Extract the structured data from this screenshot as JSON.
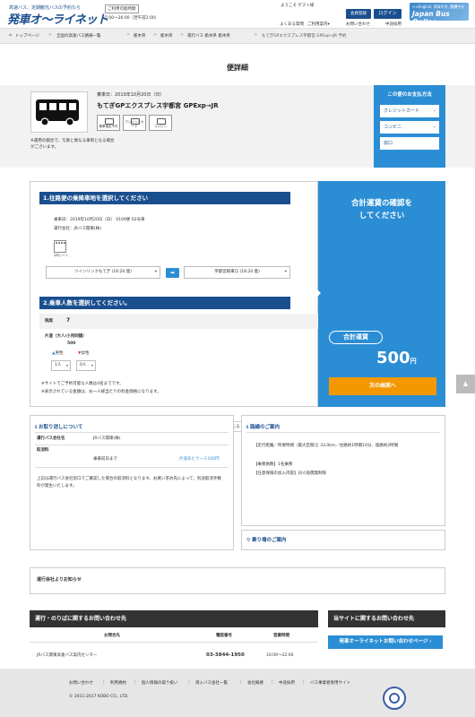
{
  "header": {
    "tagline": "高速バス、定期観光バスの予約なら",
    "logo": "発車オ〜ライネット",
    "hours_label": "ご利用可能時間",
    "hours": "5:00〜26:00（翌午前2:00）",
    "welcome": "ようこそ ゲスト様",
    "register": "会員登録",
    "login": "ログイン",
    "faq": "よくある質問",
    "guide": "ご利用案内",
    "guide_chev": "▾",
    "contact": "お問い合わせ",
    "english": "中途採用",
    "banner_small": ">>English, 简体中文, 繁體中文",
    "banner_big": "Japan Bus Online"
  },
  "breadcrumb": {
    "home_icon": "⌂",
    "items": [
      "トップページ",
      "全国の高速バス路線一覧",
      "栃木県",
      "栃木県",
      "夜行バス 栃木県 栃木県",
      "もてぎGPエクスプレス宇都宮 GPExp→JR 予約"
    ],
    "sep": ">"
  },
  "page_title": "便詳細",
  "trip": {
    "date": "乗車日：2019年10月20日（日）",
    "route": "もてぎGPエクスプレス宇都宮 GPExp→JR",
    "amenities": [
      "乗車指定不可",
      "クレジットカード",
      "コンビニ"
    ],
    "bus_note": "※運用の都合で、写真と異なる車両となる場合がございます。"
  },
  "payment": {
    "heading": "この便のお支払方法",
    "methods": [
      "クレジットカード",
      "コンビニ",
      "窓口"
    ],
    "chev": "›"
  },
  "step1": {
    "heading": "1.往路便の乗降車地を選択してください",
    "date_line": "乗車日：2019年10月20日（日） 0109便 02号車",
    "operator": "運行会社：JRバス関東(株)",
    "seat_label": "4列シート",
    "from": "ツインリンクもてぎ (16:20 発)",
    "to": "宇都宮駅東口 (18:20 着)",
    "arrow": "➡",
    "chev": "▾"
  },
  "step2": {
    "heading": "2.乗車人数を選択してください。",
    "trip_label": "残席",
    "remaining": "7",
    "fare_label": "片道（大人/小児同額）",
    "fare": "500",
    "male_icon": "▲",
    "male": "男性",
    "female_icon": "▼",
    "female": "女性",
    "male_count": "1人",
    "female_count": "0人",
    "chev": "▾",
    "note1": "※サイトでご予約可能な人数は4名までです。",
    "note2": "※表示されている金額は、お一人様当たりの料金価格になります。"
  },
  "total": {
    "message_l1": "合計運賃の確認を",
    "message_l2": "してください",
    "fare_label": "合計運賃",
    "amount": "500",
    "yen": "円",
    "next": "次の画面へ"
  },
  "close_label": "閉じる",
  "close_icon": "▲",
  "cancel": {
    "icon": "ℹ",
    "heading": "お取り消しについて",
    "operator_label": "運行バス会社名",
    "operator": "JRバス関東(株)",
    "fee_label": "取消料",
    "until_label": "乗車前日まで",
    "fee_value": "片道あたり一人100円",
    "note": "上記は運行バス会社窓口でご確認した場合の取消料となります。お買い求め先によって、別途取消手数料が発生いたします。"
  },
  "route_info": {
    "icon": "ℹ",
    "heading": "路線のご案内",
    "l1": "【走行距離／所要時間（最大区間）】33.0km／往路約1時間10分、復路約2時間",
    "l2": "【乗務員数】1名乗務",
    "l3": "【任意保険の加入内容】対人賠償無制限"
  },
  "stops": {
    "icon": "⚲",
    "heading": "乗り場のご案内"
  },
  "operator_notice": "運行会社よりお知らせ",
  "contact": {
    "heading": "運行・のりばに関するお問い合わせ先",
    "col1": "お問合先",
    "col2": "電話番号",
    "col3": "営業時間",
    "name": "JRバス関東高速バス案内センター",
    "phone": "03-3844-1950",
    "hours": "10:00〜22:00",
    "site_heading": "当サイトに関するお問い合わせ先",
    "site_button": "発車オーライネットお問い合わせページ ›"
  },
  "footer": {
    "links": [
      "お問い合わせ",
      "利用規約",
      "個人情報の取り扱い",
      "導入バス会社一覧",
      "会社概要",
      "中途採用",
      "バス事業者専用サイト"
    ],
    "sep": "|",
    "copyright": "© 2011-2017 KOBO CO., LTD."
  },
  "page_top": "▲",
  "colors": {
    "navy": "#1a4f8f",
    "blue": "#2b8ed5",
    "orange": "#f39800"
  }
}
